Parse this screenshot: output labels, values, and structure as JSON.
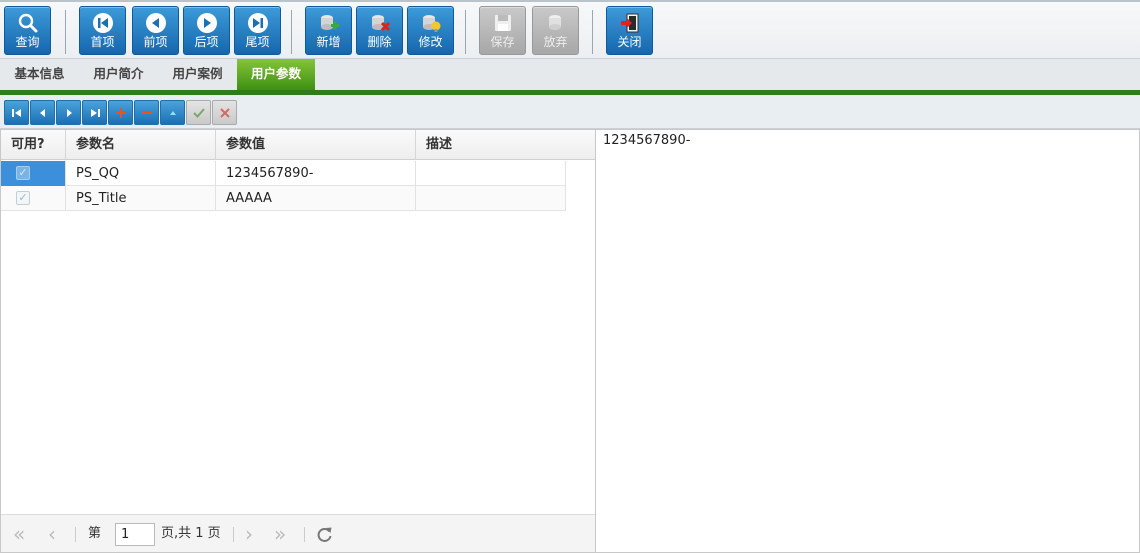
{
  "toolbar": {
    "query": "查询",
    "first": "首项",
    "prev": "前项",
    "next": "后项",
    "last": "尾项",
    "add": "新增",
    "delete": "删除",
    "edit": "修改",
    "save": "保存",
    "discard": "放弃",
    "close": "关闭"
  },
  "tabs": [
    "基本信息",
    "用户简介",
    "用户案例",
    "用户参数"
  ],
  "grid": {
    "columns": [
      "可用?",
      "参数名",
      "参数值",
      "描述"
    ],
    "rows": [
      {
        "enabled": "✓",
        "name": "PS_QQ",
        "value": "1234567890-",
        "desc": ""
      },
      {
        "enabled": "✓",
        "name": "PS_Title",
        "value": "AAAAA",
        "desc": ""
      }
    ]
  },
  "pager": {
    "page_prefix": "第",
    "page_value": "1",
    "page_suffix": "页,共 1 页"
  },
  "detail": {
    "text": "1234567890-"
  },
  "colors": {
    "accent_blue": "#1567ad",
    "tab_green": "#3f8f12",
    "selection": "#3b8fdb"
  }
}
